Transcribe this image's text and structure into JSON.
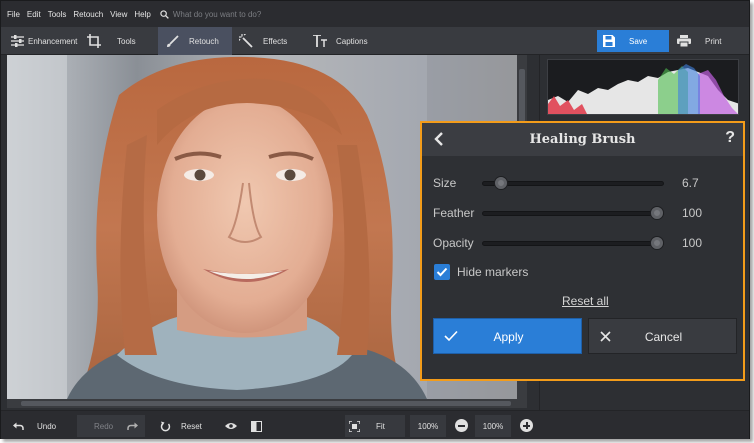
{
  "menu": {
    "items": [
      "File",
      "Edit",
      "Tools",
      "Retouch",
      "View",
      "Help"
    ],
    "search_placeholder": "What do you want to do?"
  },
  "toolbar": {
    "tabs": [
      {
        "label": "Enhancement",
        "icon": "sliders-icon"
      },
      {
        "label": "Tools",
        "icon": "crop-icon"
      },
      {
        "label": "Retouch",
        "icon": "brush-icon",
        "active": true
      },
      {
        "label": "Effects",
        "icon": "magic-wand-icon"
      },
      {
        "label": "Captions",
        "icon": "text-icon"
      }
    ],
    "save_label": "Save",
    "print_label": "Print"
  },
  "healing_brush": {
    "title": "Healing Brush",
    "help": "?",
    "sliders": [
      {
        "label": "Size",
        "value": "6.7",
        "level": 0.07
      },
      {
        "label": "Feather",
        "value": "100",
        "level": 1.0
      },
      {
        "label": "Opacity",
        "value": "100",
        "level": 1.0
      }
    ],
    "hide_markers_label": "Hide markers",
    "hide_markers_checked": true,
    "reset_all_label": "Reset all",
    "apply_label": "Apply",
    "cancel_label": "Cancel"
  },
  "bottombar": {
    "undo_label": "Undo",
    "redo_label": "Redo",
    "reset_label": "Reset",
    "fit_label": "Fit",
    "zoom_1": "100%",
    "zoom_2": "100%"
  },
  "colors": {
    "accent": "#2a7ed7",
    "panel_border": "#f39c1a",
    "background": "#2d2f33"
  }
}
